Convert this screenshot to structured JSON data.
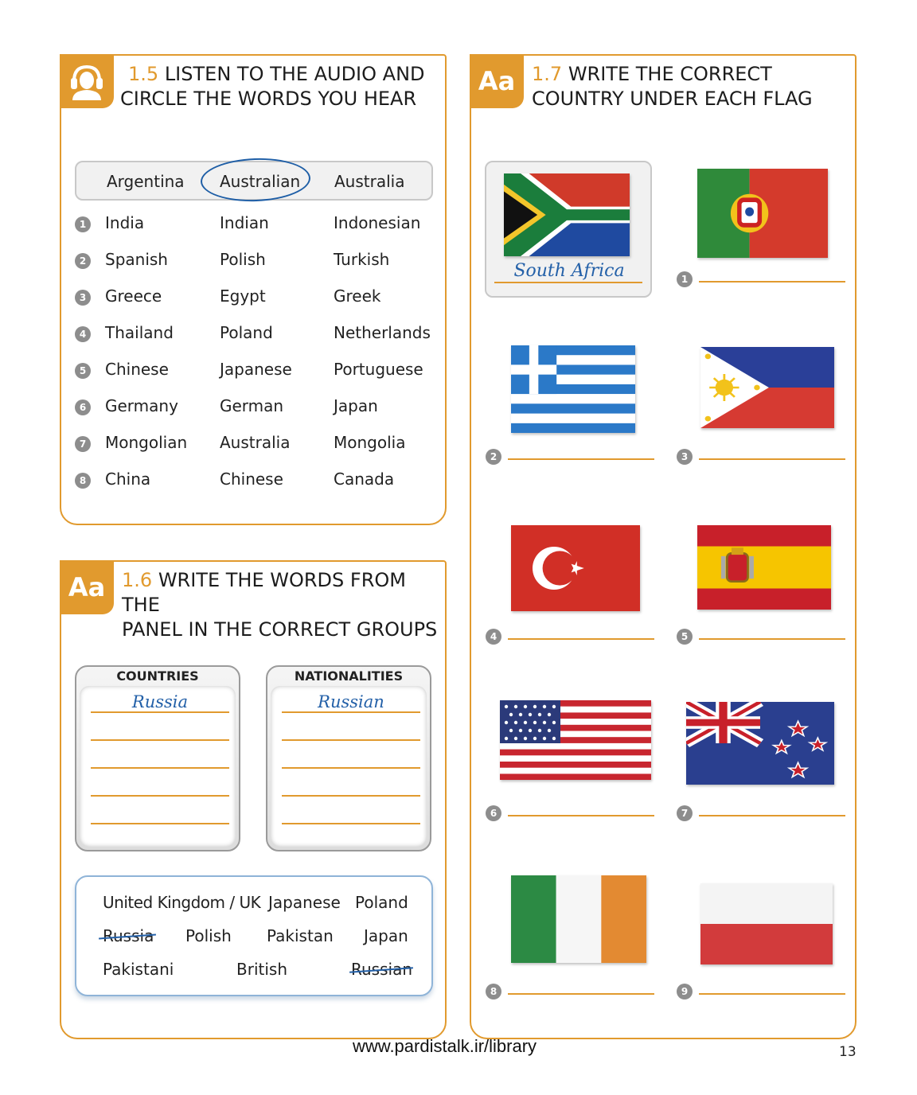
{
  "ex15": {
    "number": "1.5",
    "title_line1": "LISTEN TO THE AUDIO AND",
    "title_line2": "CIRCLE THE WORDS YOU HEAR",
    "icon": "headphones-person-icon",
    "example": [
      "Argentina",
      "Australian",
      "Australia"
    ],
    "rows": [
      {
        "n": "1",
        "words": [
          "India",
          "Indian",
          "Indonesian"
        ]
      },
      {
        "n": "2",
        "words": [
          "Spanish",
          "Polish",
          "Turkish"
        ]
      },
      {
        "n": "3",
        "words": [
          "Greece",
          "Egypt",
          "Greek"
        ]
      },
      {
        "n": "4",
        "words": [
          "Thailand",
          "Poland",
          "Netherlands"
        ]
      },
      {
        "n": "5",
        "words": [
          "Chinese",
          "Japanese",
          "Portuguese"
        ]
      },
      {
        "n": "6",
        "words": [
          "Germany",
          "German",
          "Japan"
        ]
      },
      {
        "n": "7",
        "words": [
          "Mongolian",
          "Australia",
          "Mongolia"
        ]
      },
      {
        "n": "8",
        "words": [
          "China",
          "Chinese",
          "Canada"
        ]
      }
    ]
  },
  "ex16": {
    "badge": "Aa",
    "number": "1.6",
    "title_line1": "WRITE THE WORDS FROM THE",
    "title_line2": "PANEL IN THE CORRECT GROUPS",
    "countries_head": "COUNTRIES",
    "nationalities_head": "NATIONALITIES",
    "countries_example": "Russia",
    "nationalities_example": "Russian",
    "panel_words": [
      "United Kingdom / UK",
      "Japanese",
      "Poland",
      "Russia",
      "Polish",
      "Pakistan",
      "Japan",
      "Pakistani",
      "British",
      "Russian"
    ]
  },
  "ex17": {
    "badge": "Aa",
    "number": "1.7",
    "title_line1": "WRITE THE CORRECT",
    "title_line2": "COUNTRY UNDER EACH FLAG",
    "example_answer": "South Africa",
    "flags": [
      "south-africa-flag",
      "portugal-flag",
      "greece-flag",
      "philippines-flag",
      "turkey-flag",
      "spain-flag",
      "usa-flag",
      "new-zealand-flag",
      "ireland-flag",
      "poland-flag"
    ],
    "numbers": [
      "1",
      "2",
      "3",
      "4",
      "5",
      "6",
      "7",
      "8",
      "9"
    ]
  },
  "footer": {
    "url": "www.pardistalk.ir/library",
    "page": "13"
  },
  "colors": {
    "accent": "#e19a2e",
    "handwriting": "#2360a8",
    "number_circle": "#8d8d8d"
  }
}
